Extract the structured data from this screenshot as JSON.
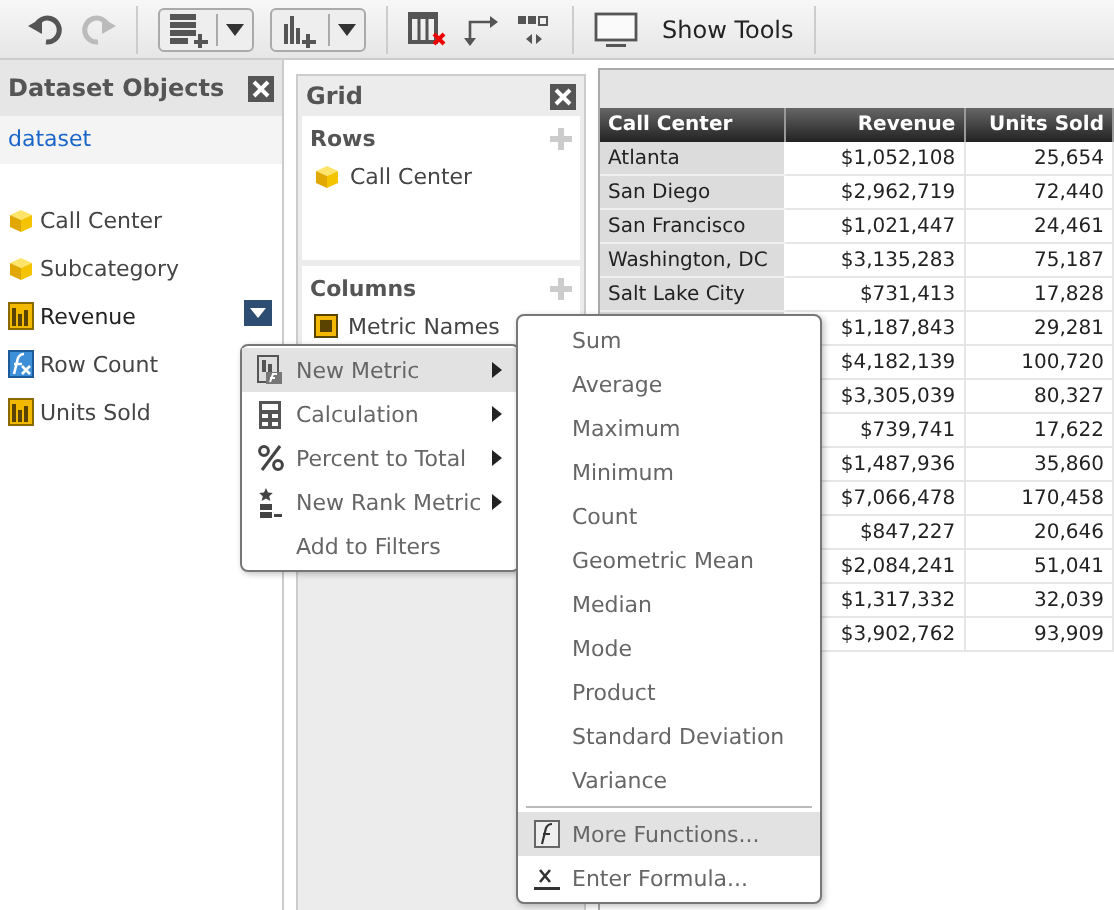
{
  "toolbar": {
    "items": [
      {
        "kind": "undo",
        "disabled": false
      },
      {
        "kind": "redo",
        "disabled": true
      },
      {
        "kind": "add-rows",
        "disabled": false
      },
      {
        "kind": "add-chart",
        "disabled": false
      },
      {
        "kind": "remove-column",
        "disabled": false
      },
      {
        "kind": "swap",
        "disabled": false
      },
      {
        "kind": "layout",
        "disabled": false
      },
      {
        "kind": "show-tools",
        "disabled": false,
        "label": "Show Tools"
      }
    ]
  },
  "dataset_objects": {
    "title": "Dataset Objects",
    "dataset": "dataset",
    "items": [
      {
        "kind": "attribute",
        "label": "Call Center",
        "selected": false
      },
      {
        "kind": "attribute",
        "label": "Subcategory",
        "selected": false
      },
      {
        "kind": "metric",
        "label": "Revenue",
        "selected": true
      },
      {
        "kind": "derived",
        "label": "Row Count",
        "selected": false
      },
      {
        "kind": "metric",
        "label": "Units Sold",
        "selected": false
      }
    ]
  },
  "grid_panel": {
    "title": "Grid",
    "rows": {
      "title": "Rows",
      "items": [
        {
          "kind": "attribute",
          "label": "Call Center"
        }
      ]
    },
    "columns": {
      "title": "Columns",
      "items": [
        {
          "kind": "metric-names",
          "label": "Metric Names"
        }
      ]
    }
  },
  "table": {
    "columns": [
      "Call Center",
      "Revenue",
      "Units Sold"
    ],
    "rows": [
      [
        "Atlanta",
        "$1,052,108",
        "25,654"
      ],
      [
        "San Diego",
        "$2,962,719",
        "72,440"
      ],
      [
        "San Francisco",
        "$1,021,447",
        "24,461"
      ],
      [
        "Washington, DC",
        "$3,135,283",
        "75,187"
      ],
      [
        "Salt Lake City",
        "$731,413",
        "17,828"
      ],
      [
        null,
        "$1,187,843",
        "29,281"
      ],
      [
        null,
        "$4,182,139",
        "100,720"
      ],
      [
        null,
        "$3,305,039",
        "80,327"
      ],
      [
        null,
        "$739,741",
        "17,622"
      ],
      [
        null,
        "$1,487,936",
        "35,860"
      ],
      [
        null,
        "$7,066,478",
        "170,458"
      ],
      [
        null,
        "$847,227",
        "20,646"
      ],
      [
        null,
        "$2,084,241",
        "51,041"
      ],
      [
        null,
        "$1,317,332",
        "32,039"
      ],
      [
        null,
        "$3,902,762",
        "93,909"
      ]
    ]
  },
  "context_menu": {
    "items": [
      {
        "kind": "new-metric",
        "label": "New Metric",
        "submenu": true,
        "selected": true
      },
      {
        "kind": "calculation",
        "label": "Calculation",
        "submenu": true,
        "selected": false
      },
      {
        "kind": "percent",
        "label": "Percent to Total",
        "submenu": true,
        "selected": false
      },
      {
        "kind": "rank",
        "label": "New Rank Metric",
        "submenu": true,
        "selected": false
      },
      {
        "kind": "plain",
        "label": "Add to Filters",
        "submenu": false,
        "selected": false
      }
    ]
  },
  "submenu": {
    "items": [
      {
        "kind": "plain",
        "label": "Sum",
        "selected": false
      },
      {
        "kind": "plain",
        "label": "Average",
        "selected": false
      },
      {
        "kind": "plain",
        "label": "Maximum",
        "selected": false
      },
      {
        "kind": "plain",
        "label": "Minimum",
        "selected": false
      },
      {
        "kind": "plain",
        "label": "Count",
        "selected": false
      },
      {
        "kind": "plain",
        "label": "Geometric Mean",
        "selected": false
      },
      {
        "kind": "plain",
        "label": "Median",
        "selected": false
      },
      {
        "kind": "plain",
        "label": "Mode",
        "selected": false
      },
      {
        "kind": "plain",
        "label": "Product",
        "selected": false
      },
      {
        "kind": "plain",
        "label": "Standard Deviation",
        "selected": false
      },
      {
        "kind": "plain",
        "label": "Variance",
        "selected": false
      },
      {
        "kind": "separator"
      },
      {
        "kind": "function",
        "label": "More Functions...",
        "selected": true
      },
      {
        "kind": "formula",
        "label": "Enter Formula...",
        "selected": false
      }
    ]
  }
}
